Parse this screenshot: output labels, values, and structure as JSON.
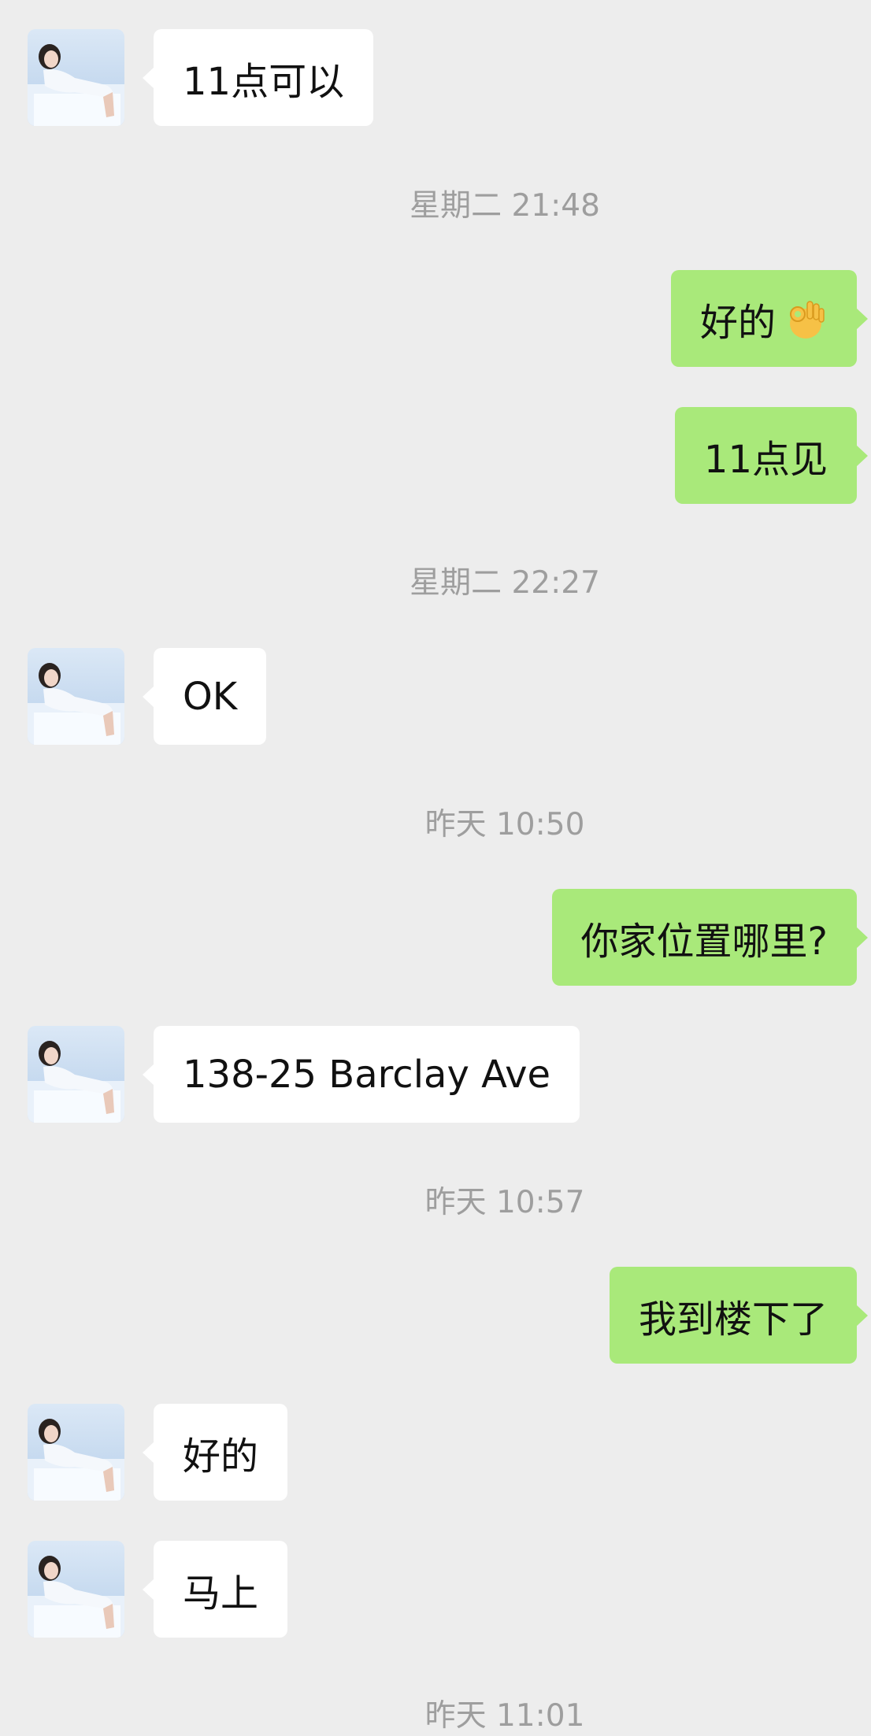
{
  "contact": {
    "avatar_icon": "woman-profile-photo"
  },
  "messages": [
    {
      "type": "in",
      "text": "11点可以"
    },
    {
      "type": "time",
      "text": "星期二 21:48"
    },
    {
      "type": "out",
      "text": "好的",
      "emoji": "ok-hand-emoji"
    },
    {
      "type": "out",
      "text": "11点见"
    },
    {
      "type": "time",
      "text": "星期二 22:27"
    },
    {
      "type": "in",
      "text": "OK"
    },
    {
      "type": "time",
      "text": "昨天 10:50"
    },
    {
      "type": "out",
      "text": "你家位置哪里?"
    },
    {
      "type": "in",
      "text": "138-25 Barclay Ave"
    },
    {
      "type": "time",
      "text": "昨天 10:57"
    },
    {
      "type": "out",
      "text": "我到楼下了"
    },
    {
      "type": "in",
      "text": "好的"
    },
    {
      "type": "in",
      "text": "马上"
    },
    {
      "type": "time",
      "text": "昨天 11:01"
    }
  ],
  "colors": {
    "background": "#ededed",
    "incoming_bubble": "#ffffff",
    "outgoing_bubble": "#a9e97a",
    "timestamp_text": "#9e9e9e"
  }
}
